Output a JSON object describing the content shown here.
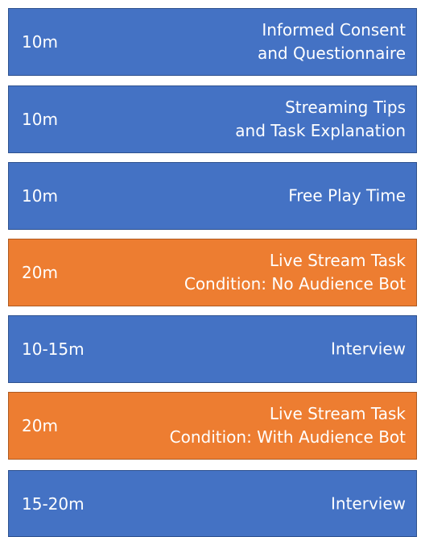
{
  "colors": {
    "blue": "#4472c4",
    "orange": "#ed7d31",
    "text": "#ffffff"
  },
  "steps": [
    {
      "duration": "10m",
      "lines": [
        "Informed Consent",
        "and Questionnaire"
      ],
      "color": "blue"
    },
    {
      "duration": "10m",
      "lines": [
        "Streaming Tips",
        "and Task Explanation"
      ],
      "color": "blue"
    },
    {
      "duration": "10m",
      "lines": [
        "Free Play Time"
      ],
      "color": "blue"
    },
    {
      "duration": "20m",
      "lines": [
        "Live Stream Task",
        "Condition: No Audience Bot"
      ],
      "color": "orange"
    },
    {
      "duration": "10-15m",
      "lines": [
        "Interview"
      ],
      "color": "blue"
    },
    {
      "duration": "20m",
      "lines": [
        "Live Stream Task",
        "Condition: With Audience Bot"
      ],
      "color": "orange"
    },
    {
      "duration": "15-20m",
      "lines": [
        "Interview"
      ],
      "color": "blue"
    }
  ]
}
